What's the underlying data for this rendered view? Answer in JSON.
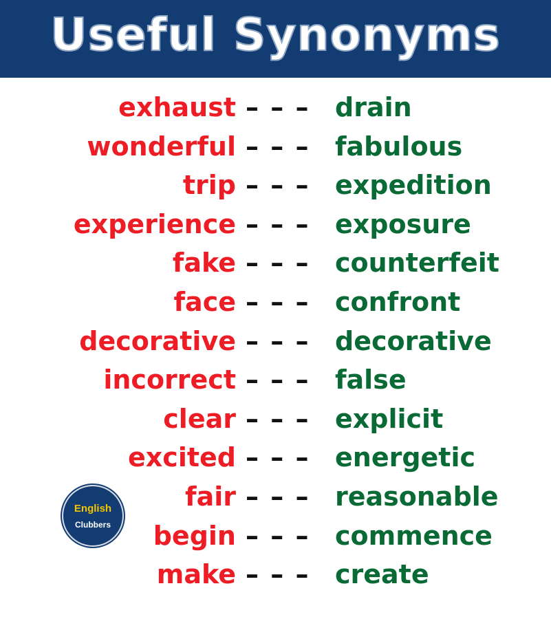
{
  "title": "Useful Synonyms",
  "colors": {
    "header_bg": "#133d72",
    "word": "#ee1c24",
    "synonym": "#0a6a35",
    "dash": "#111111"
  },
  "separator": "– – –",
  "pairs": [
    {
      "word": "exhaust",
      "synonym": "drain"
    },
    {
      "word": "wonderful",
      "synonym": "fabulous"
    },
    {
      "word": "trip",
      "synonym": "expedition"
    },
    {
      "word": "experience",
      "synonym": "exposure"
    },
    {
      "word": "fake",
      "synonym": "counterfeit"
    },
    {
      "word": "face",
      "synonym": "confront"
    },
    {
      "word": "decorative",
      "synonym": "decorative"
    },
    {
      "word": "incorrect",
      "synonym": "false"
    },
    {
      "word": "clear",
      "synonym": "explicit"
    },
    {
      "word": "excited",
      "synonym": "energetic"
    },
    {
      "word": "fair",
      "synonym": "reasonable"
    },
    {
      "word": "begin",
      "synonym": "commence"
    },
    {
      "word": "make",
      "synonym": "create"
    }
  ],
  "badge": {
    "line1": "English",
    "line2": "Clubbers"
  }
}
